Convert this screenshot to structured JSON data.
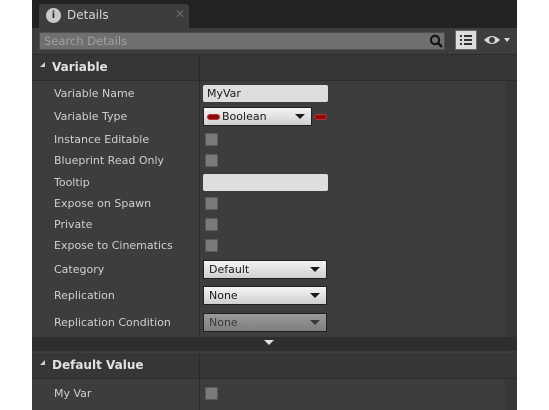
{
  "tab": {
    "label": "Details",
    "icon": "info-icon",
    "close": "✕"
  },
  "search": {
    "placeholder": "Search Details"
  },
  "sections": {
    "variable": {
      "title": "Variable",
      "rows": {
        "variable_name": {
          "label": "Variable Name",
          "value": "MyVar"
        },
        "variable_type": {
          "label": "Variable Type",
          "value": "Boolean",
          "pin_color": "#8a0d0d"
        },
        "instance_editable": {
          "label": "Instance Editable",
          "checked": false
        },
        "blueprint_read_only": {
          "label": "Blueprint Read Only",
          "checked": false
        },
        "tooltip": {
          "label": "Tooltip",
          "value": ""
        },
        "expose_on_spawn": {
          "label": "Expose on Spawn",
          "checked": false
        },
        "private": {
          "label": "Private",
          "checked": false
        },
        "expose_to_cinematics": {
          "label": "Expose to Cinematics",
          "checked": false
        },
        "category": {
          "label": "Category",
          "value": "Default"
        },
        "replication": {
          "label": "Replication",
          "value": "None"
        },
        "replication_condition": {
          "label": "Replication Condition",
          "value": "None",
          "disabled": true
        }
      }
    },
    "default_value": {
      "title": "Default Value",
      "rows": {
        "my_var": {
          "label": "My Var",
          "checked": false
        }
      }
    }
  },
  "colors": {
    "panel_bg": "#3d3d3d",
    "header_bg": "#363636",
    "tab_strip": "#222222",
    "text": "#d0d0d0",
    "boolean_pin": "#8a0d0d"
  }
}
